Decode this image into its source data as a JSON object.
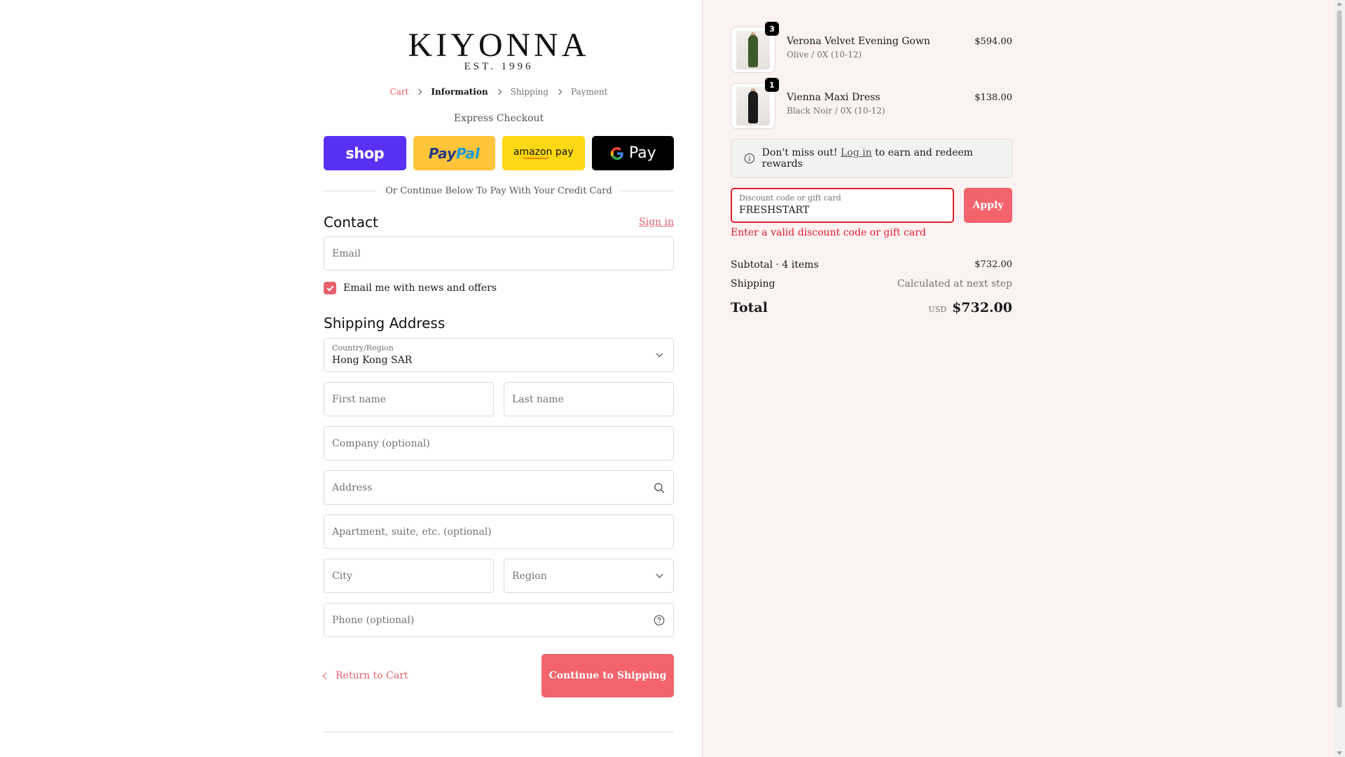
{
  "brand": {
    "name": "KIYONNA",
    "est": "EST. 1996"
  },
  "breadcrumb": [
    "Cart",
    "Information",
    "Shipping",
    "Payment"
  ],
  "express": {
    "title": "Express Checkout",
    "shop_label": "shop",
    "paypal_label_1": "Pay",
    "paypal_label_2": "Pal",
    "amazon_label": "amazon pay",
    "gpay_label": "Pay"
  },
  "divider_text": "Or Continue Below To Pay With Your Credit Card",
  "contact": {
    "title": "Contact",
    "sign_in": "Sign in",
    "email_placeholder": "Email",
    "newsletter_label": "Email me with news and offers",
    "newsletter_checked": true
  },
  "shipping": {
    "title": "Shipping Address",
    "country_label": "Country/Region",
    "country_value": "Hong Kong SAR",
    "first_name": "First name",
    "last_name": "Last name",
    "company": "Company (optional)",
    "address": "Address",
    "apartment": "Apartment, suite, etc. (optional)",
    "city": "City",
    "region": "Region",
    "phone": "Phone (optional)"
  },
  "actions": {
    "return": "Return to Cart",
    "continue": "Continue to Shipping"
  },
  "cart_items": [
    {
      "name": "Verona Velvet Evening Gown",
      "variant": "Olive / 0X (10-12)",
      "price": "$594.00",
      "qty": "3",
      "color": "#3f5a2a"
    },
    {
      "name": "Vienna Maxi Dress",
      "variant": "Black Noir / 0X (10-12)",
      "price": "$138.00",
      "qty": "1",
      "color": "#1a1a1a"
    }
  ],
  "rewards": {
    "prefix": "Don't miss out!",
    "link": "Log in",
    "suffix": "to earn and redeem rewards"
  },
  "discount": {
    "label": "Discount code or gift card",
    "value": "FRESHSTART",
    "apply": "Apply",
    "error": "Enter a valid discount code or gift card"
  },
  "totals": {
    "subtotal_label": "Subtotal · 4 items",
    "subtotal_value": "$732.00",
    "shipping_label": "Shipping",
    "shipping_value": "Calculated at next step",
    "total_label": "Total",
    "currency": "USD",
    "total_value": "$732.00"
  },
  "colors": {
    "accent": "#f2636c",
    "error": "#dd1d2e",
    "summary_bg": "#fdf2f2",
    "shop_pay": "#5a31f4",
    "paypal": "#ffc439",
    "amazon": "#ffd814"
  }
}
